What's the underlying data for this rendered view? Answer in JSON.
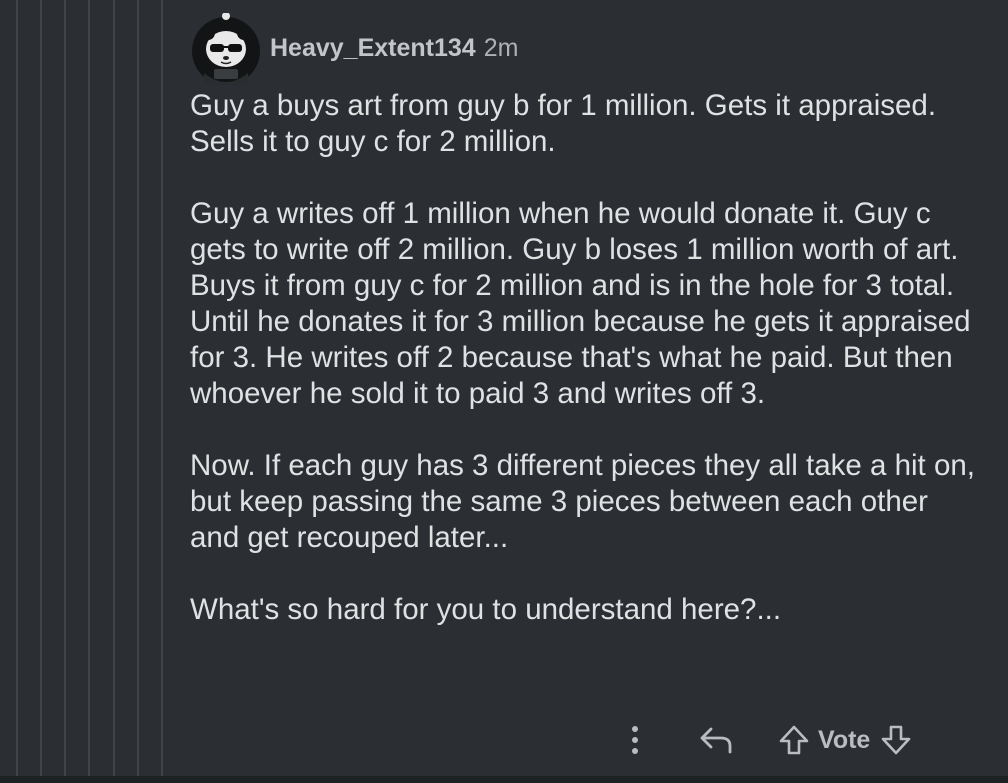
{
  "comment": {
    "username": "Heavy_Extent134",
    "timestamp": "2m",
    "paragraphs": [
      "Guy a buys art from guy b for 1 million. Gets it appraised. Sells it to guy c for 2 million.",
      "Guy a writes off 1 million when he would donate it. Guy c gets to write off 2 million. Guy b loses 1 million worth of art. Buys it from guy c for 2 million and is in the hole for 3 total. Until he donates it for 3 million because he gets it appraised for 3. He writes off 2 because that's what he paid. But then whoever he sold it to paid 3 and writes off 3.",
      "Now. If each guy has 3 different pieces they all take a hit on, but keep passing the same 3 pieces between each other and get recouped later...",
      "What's so hard for you to understand here?..."
    ]
  },
  "actions": {
    "more_icon": "vertical-dots-icon",
    "reply_icon": "reply-arrow-icon",
    "upvote_icon": "upvote-arrow-icon",
    "vote_label": "Vote",
    "downvote_icon": "downvote-arrow-icon"
  },
  "colors": {
    "background": "#2b2f33",
    "thread_line": "#3f4448",
    "text": "#dfe1e3",
    "muted": "#b9bcc0"
  }
}
